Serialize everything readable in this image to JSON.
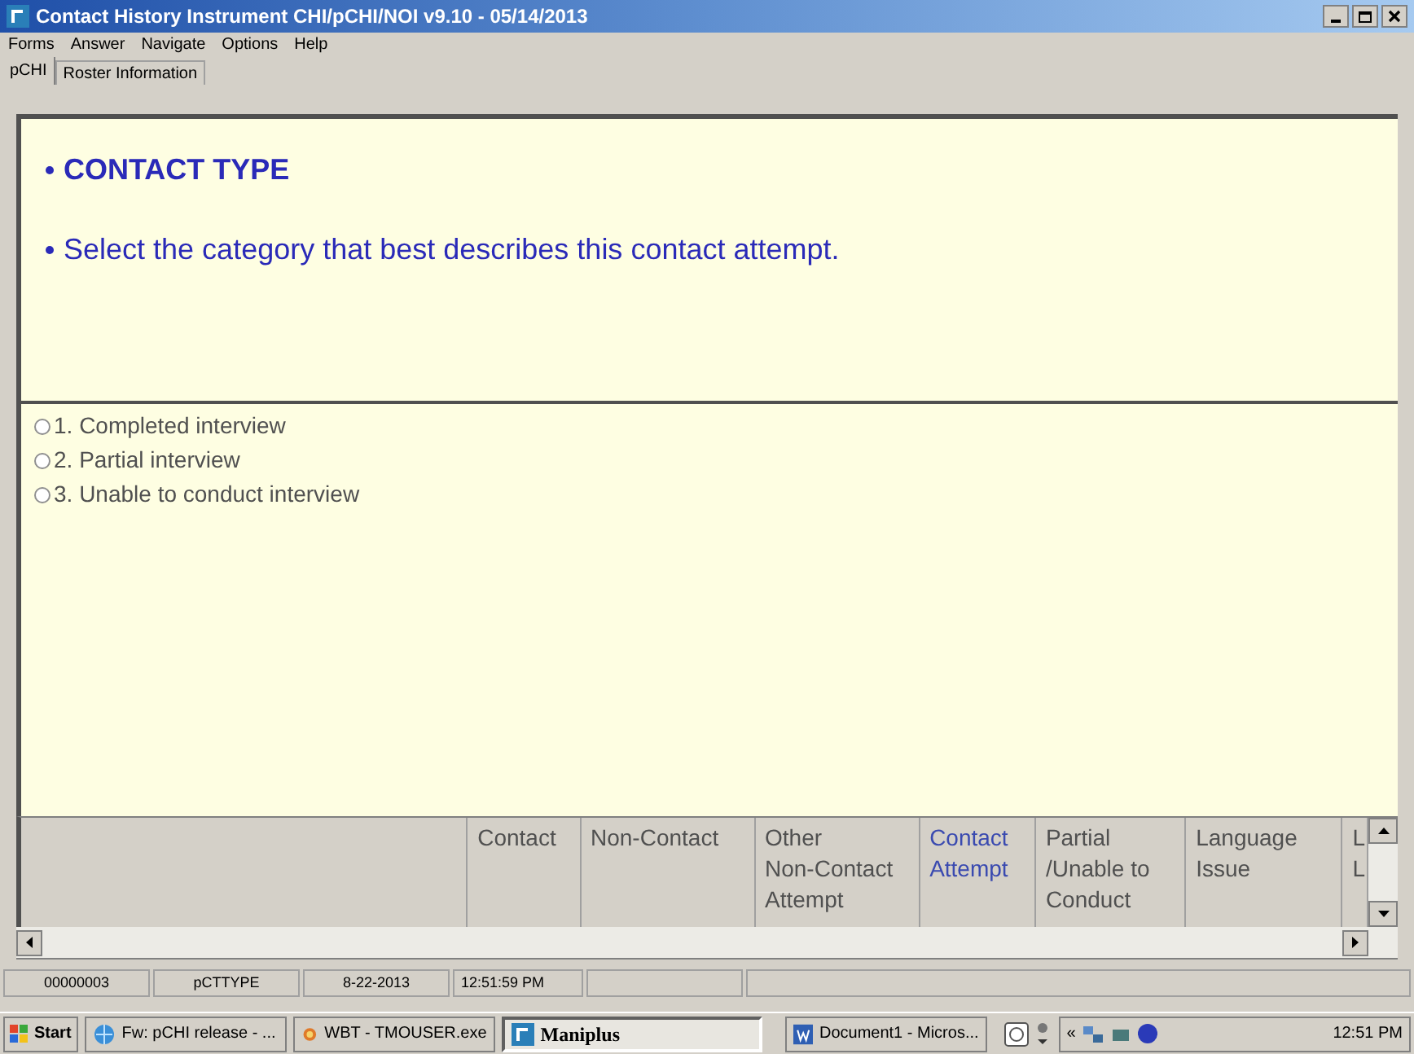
{
  "window": {
    "title": "Contact History Instrument CHI/pCHI/NOI v9.10 - 05/14/2013"
  },
  "menu": [
    "Forms",
    "Answer",
    "Navigate",
    "Options",
    "Help"
  ],
  "tabs": [
    {
      "label": "pCHI",
      "selected": true
    },
    {
      "label": "Roster Information",
      "selected": false
    }
  ],
  "question": [
    "CONTACT TYPE",
    "Select the category that best describes this contact attempt."
  ],
  "options": [
    {
      "label": "1. Completed interview",
      "selected": false
    },
    {
      "label": "2. Partial interview",
      "selected": false
    },
    {
      "label": "3. Unable to conduct interview",
      "selected": false
    }
  ],
  "nav_columns": [
    {
      "lines": [
        "Contact"
      ],
      "selected": false
    },
    {
      "lines": [
        "Non-Contact"
      ],
      "selected": false
    },
    {
      "lines": [
        "Other",
        "Non-Contact",
        "Attempt"
      ],
      "selected": false
    },
    {
      "lines": [
        "Contact",
        "Attempt"
      ],
      "selected": true
    },
    {
      "lines": [
        "Partial",
        "/Unable to",
        "Conduct"
      ],
      "selected": false
    },
    {
      "lines": [
        "Language",
        "Issue"
      ],
      "selected": false
    },
    {
      "lines": [
        "L",
        "L"
      ],
      "selected": false
    }
  ],
  "status_bar": [
    "00000003",
    "pCTTYPE",
    "8-22-2013",
    "12:51:59 PM"
  ],
  "taskbar": {
    "start": "Start",
    "tasks": [
      {
        "label": "Fw: pCHI release - ...",
        "kind": "mail",
        "selected": false
      },
      {
        "label": "WBT - TMOUSER.exe",
        "kind": "app",
        "selected": false
      },
      {
        "label": "Maniplus",
        "kind": "maniplus",
        "selected": true
      },
      {
        "label": "Document1 - Micros...",
        "kind": "word",
        "selected": false
      }
    ],
    "tray_expand": "«",
    "clock": "12:51 PM"
  }
}
